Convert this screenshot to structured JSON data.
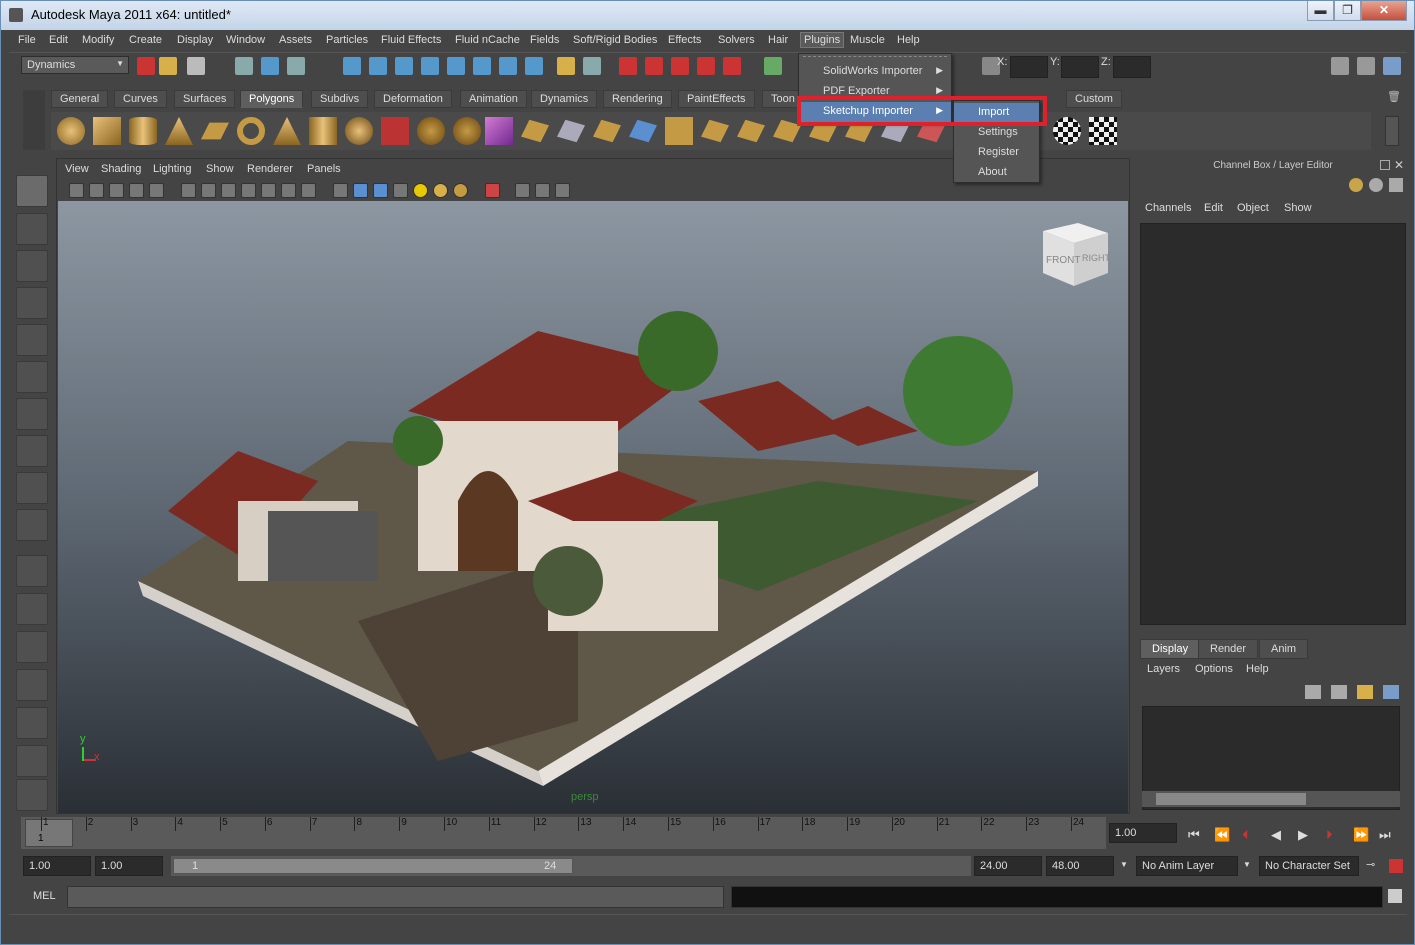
{
  "window": {
    "title": "Autodesk Maya 2011 x64: untitled*",
    "min": "▬",
    "max": "❐",
    "close": "✕"
  },
  "menubar": [
    "File",
    "Edit",
    "Modify",
    "Create",
    "Display",
    "Window",
    "Assets",
    "Particles",
    "Fluid Effects",
    "Fluid nCache",
    "Fields",
    "Soft/Rigid Bodies",
    "Effects",
    "Solvers",
    "Hair",
    "Plugins",
    "Muscle",
    "Help"
  ],
  "status": {
    "mode": "Dynamics",
    "x_label": "X:",
    "y_label": "Y:",
    "z_label": "Z:"
  },
  "shelf_tabs": [
    "General",
    "Curves",
    "Surfaces",
    "Polygons",
    "Subdivs",
    "Deformation",
    "Animation",
    "Dynamics",
    "Rendering",
    "PaintEffects",
    "Toon",
    "Custom"
  ],
  "plugins_menu": {
    "items": [
      {
        "label": "SolidWorks Importer"
      },
      {
        "label": "PDF Exporter"
      },
      {
        "label": "Sketchup Importer"
      }
    ],
    "submenu": [
      "Import",
      "Settings",
      "Register",
      "About"
    ]
  },
  "viewport": {
    "menu": [
      "View",
      "Shading",
      "Lighting",
      "Show",
      "Renderer",
      "Panels"
    ],
    "camera": "persp",
    "viewcube_front": "FRONT",
    "viewcube_right": "RIGHT",
    "axis_y": "y",
    "axis_x": "x"
  },
  "channel_box": {
    "title": "Channel Box / Layer Editor",
    "menu": [
      "Channels",
      "Edit",
      "Object",
      "Show"
    ],
    "layer_tabs": [
      "Display",
      "Render",
      "Anim"
    ],
    "layer_menu": [
      "Layers",
      "Options",
      "Help"
    ]
  },
  "timeline": {
    "ticks": [
      "1",
      "2",
      "3",
      "4",
      "5",
      "6",
      "7",
      "8",
      "9",
      "10",
      "11",
      "12",
      "13",
      "14",
      "15",
      "16",
      "17",
      "18",
      "19",
      "20",
      "21",
      "22",
      "23",
      "24"
    ],
    "current_frame": "1.00",
    "cursor_label": "1"
  },
  "range": {
    "start": "1.00",
    "start2": "1.00",
    "slider_start": "1",
    "slider_end": "24",
    "end": "24.00",
    "end2": "48.00",
    "anim_layer": "No Anim Layer",
    "char_set": "No Character Set"
  },
  "command_line": {
    "label": "MEL"
  },
  "colors": {
    "accent_highlight": "#5b7fb0",
    "callout": "#e0202a",
    "ui_bg": "#444444"
  }
}
